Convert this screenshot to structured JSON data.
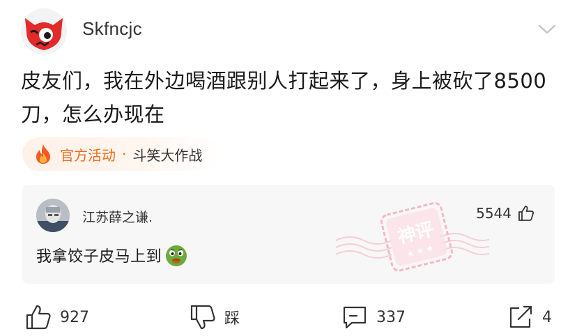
{
  "post": {
    "username": "Skfncjc",
    "text": "皮友们，我在外边喝酒跟别人打起来了，身上被砍了8500刀，怎么办现在"
  },
  "tag": {
    "label": "官方活动",
    "separator": "·",
    "event": "斗笑大作战"
  },
  "comment": {
    "username": "江苏薛之谦.",
    "likes": "5544",
    "text": "我拿饺子皮马上到",
    "stamp_text": "神评"
  },
  "actions": {
    "like_count": "927",
    "dislike_label": "踩",
    "comment_count": "337",
    "share_count": "4"
  },
  "colors": {
    "accent_orange": "#ee6a17",
    "stamp_pink": "#f6b8c4",
    "avatar_red": "#e32a2a"
  }
}
